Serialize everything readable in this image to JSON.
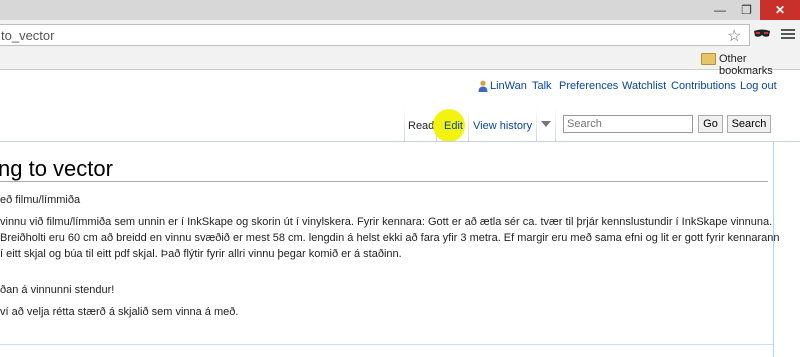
{
  "browser": {
    "url": "to_vector",
    "bookmarks": {
      "other_label": "Other bookmarks"
    }
  },
  "personal": {
    "user": "LinWan",
    "talk": "Talk",
    "preferences": "Preferences",
    "watchlist": "Watchlist",
    "contributions": "Contributions",
    "logout": "Log out"
  },
  "tabs": {
    "read": "Read",
    "edit": "Edit",
    "history": "View history"
  },
  "search": {
    "placeholder": "Search",
    "go_label": "Go",
    "search_label": "Search"
  },
  "page": {
    "title": "ng to vector",
    "subtitle": "eð filmu/límmiða",
    "lines": [
      "vinnu við filmu/límmiða sem unnin er í InkSkape og skorin út í vinylskera. Fyrir kennara: Gott er að ætla sér ca. tvær til þrjár kennslustundir í InkSkape vinnuna.",
      "Breiðholti eru 60 cm að breidd en vinnu svæðið er mest 58 cm. lengdin á helst ekki að fara yfir 3 metra. Ef margir eru með sama efni og lit er gott fyrir kennarann",
      "í eitt skjal og búa til eitt pdf skjal. Það flýtir fyrir allri vinnu þegar komið er á staðinn."
    ],
    "line4": "ðan á vinnunni stendur!",
    "line5": "ví að velja rétta stærð á skjalið sem vinna á með."
  }
}
